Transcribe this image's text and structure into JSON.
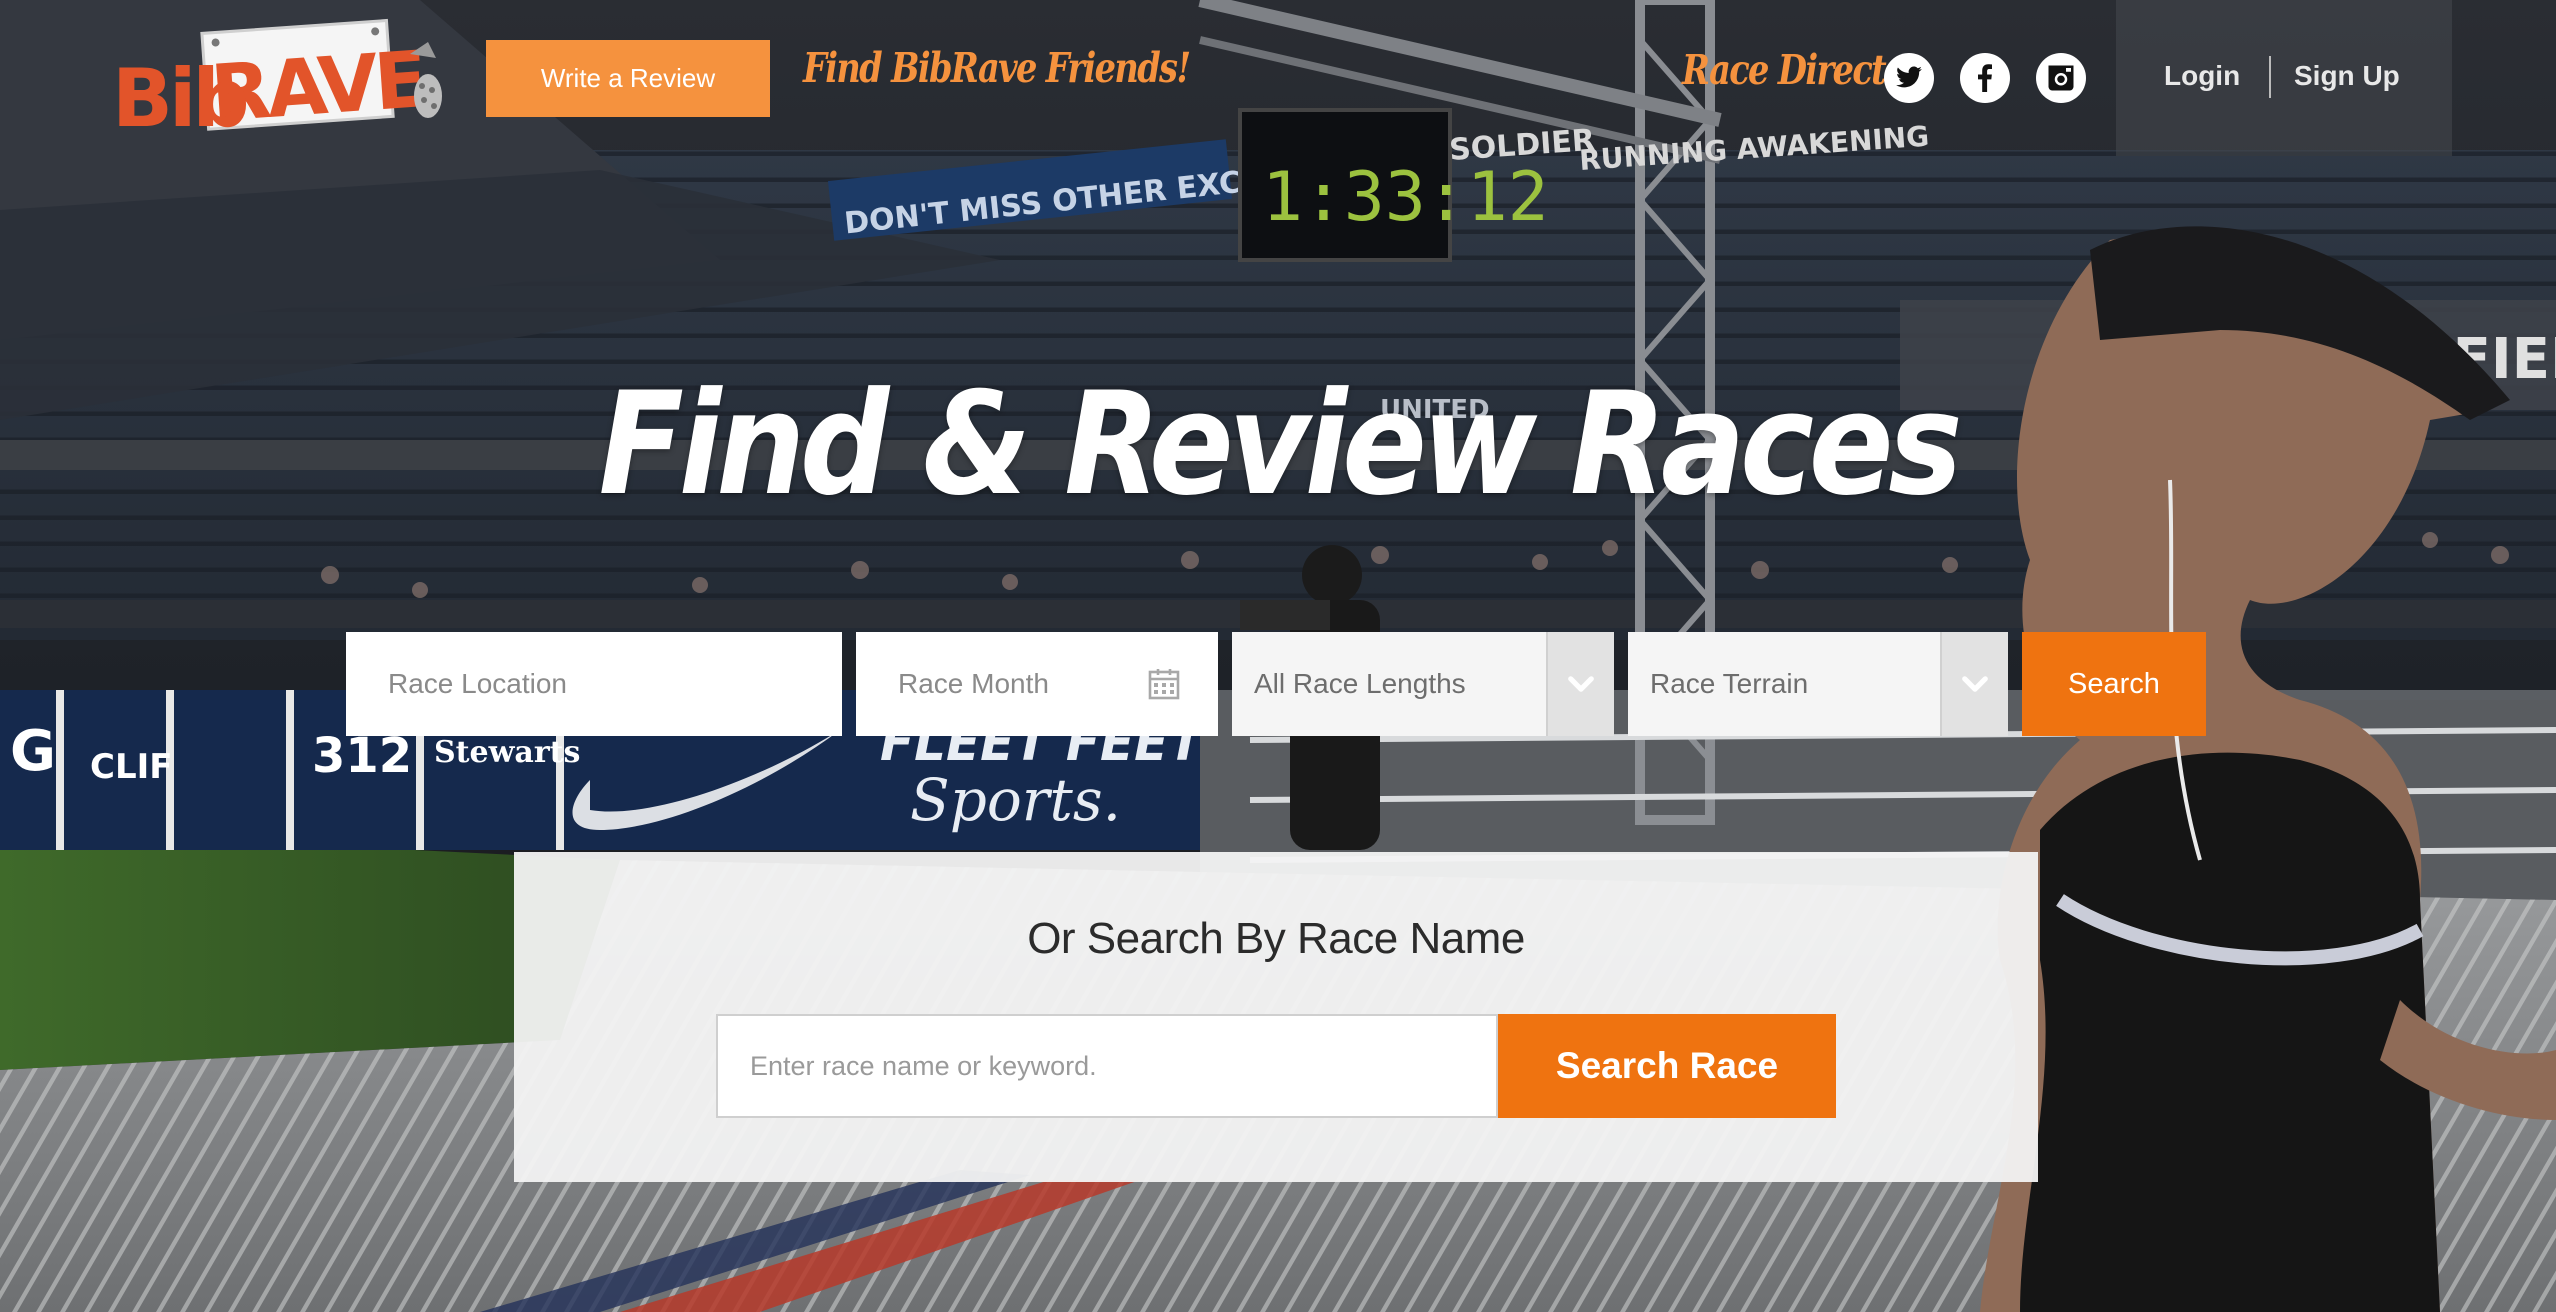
{
  "header": {
    "logo": {
      "text_bib": "Bib",
      "text_rave": "RAVE"
    },
    "write_review_label": "Write a Review",
    "find_friends_label": "Find BibRave Friends!",
    "race_director_label": "Race Director",
    "social": [
      "twitter-icon",
      "facebook-icon",
      "instagram-icon"
    ],
    "login_label": "Login",
    "signup_label": "Sign Up"
  },
  "scene_text": {
    "scoreboard": "1:33:12",
    "banner": "DON'T MISS OTHER EXCITING SUMM",
    "soldier": "SOLDIER",
    "field": "R FIEL",
    "united": "UNITED",
    "running_awaken": "RUNNING AWAKENING",
    "board_gatorade": "G",
    "board_clif": "CLIF",
    "board_312": "312",
    "board_stewarts": "Stewarts",
    "board_fleetfeet": "FLEET FEET",
    "board_sports": "Sports."
  },
  "hero": {
    "title": "Find & Review Races"
  },
  "filters": {
    "location_placeholder": "Race Location",
    "month_placeholder": "Race Month",
    "lengths_selected": "All Race Lengths",
    "terrain_selected": "Race Terrain",
    "search_label": "Search"
  },
  "name_search": {
    "title": "Or Search By Race Name",
    "input_placeholder": "Enter race name or keyword.",
    "button_label": "Search Race"
  },
  "colors": {
    "brand_orange": "#ef7310",
    "accent_orange": "#f5923e",
    "logo_red": "#e2542a"
  }
}
